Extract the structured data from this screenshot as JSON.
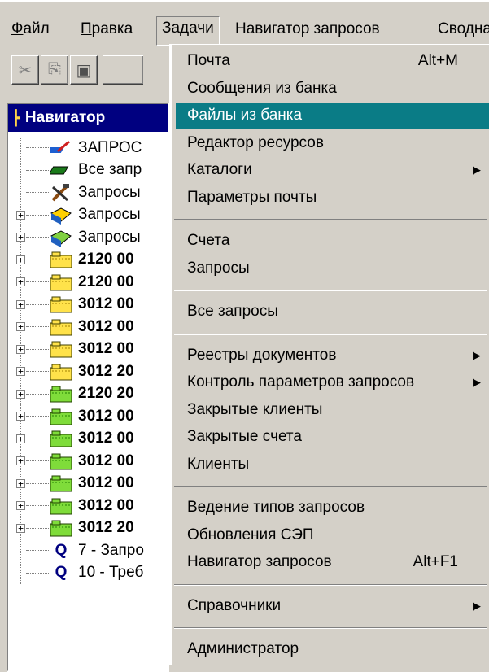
{
  "menubar": {
    "items": [
      {
        "label": "Файл",
        "mnemonic": "Ф",
        "rest": "айл"
      },
      {
        "label": "Правка",
        "mnemonic": "П",
        "rest": "равка"
      },
      {
        "label": "Задачи"
      },
      {
        "label": "Навигатор запросов"
      },
      {
        "label": "Сводна"
      }
    ]
  },
  "toolbar": {
    "buttons": [
      {
        "icon": "scissors-icon",
        "glyph": "✂"
      },
      {
        "icon": "copy-icon",
        "glyph": "⎘"
      },
      {
        "icon": "paste-icon",
        "glyph": "▣"
      }
    ]
  },
  "navigator": {
    "title": "Навигатор",
    "items": [
      {
        "label": "ЗАПРОС",
        "icon": "pencil-book-icon",
        "bold": false,
        "expander": false
      },
      {
        "label": "Все запр",
        "icon": "green-book-icon",
        "bold": false,
        "expander": false
      },
      {
        "label": "Запросы",
        "icon": "tools-icon",
        "bold": false,
        "expander": false
      },
      {
        "label": "Запросы",
        "icon": "yellow-blue-folder-icon",
        "bold": false,
        "expander": true
      },
      {
        "label": "Запросы",
        "icon": "green-blue-folder-icon",
        "bold": false,
        "expander": true
      },
      {
        "label": "2120 00",
        "icon": "yellow-folder-icon",
        "bold": true,
        "expander": true
      },
      {
        "label": "2120 00",
        "icon": "yellow-folder-icon",
        "bold": true,
        "expander": true
      },
      {
        "label": "3012 00",
        "icon": "yellow-folder-icon",
        "bold": true,
        "expander": true
      },
      {
        "label": "3012 00",
        "icon": "yellow-folder-icon",
        "bold": true,
        "expander": true
      },
      {
        "label": "3012 00",
        "icon": "yellow-folder-icon",
        "bold": true,
        "expander": true
      },
      {
        "label": "3012 20",
        "icon": "yellow-folder-icon",
        "bold": true,
        "expander": true
      },
      {
        "label": "2120 20",
        "icon": "green-folder-icon",
        "bold": true,
        "expander": true
      },
      {
        "label": "3012 00",
        "icon": "green-folder-icon",
        "bold": true,
        "expander": true
      },
      {
        "label": "3012 00",
        "icon": "green-folder-icon",
        "bold": true,
        "expander": true
      },
      {
        "label": "3012 00",
        "icon": "green-folder-icon",
        "bold": true,
        "expander": true
      },
      {
        "label": "3012 00",
        "icon": "green-folder-icon",
        "bold": true,
        "expander": true
      },
      {
        "label": "3012 00",
        "icon": "green-folder-icon",
        "bold": true,
        "expander": true
      },
      {
        "label": "3012 20",
        "icon": "green-folder-icon",
        "bold": true,
        "expander": true
      },
      {
        "label": "7 - Запро",
        "icon": "q-icon",
        "bold": false,
        "expander": false
      },
      {
        "label": "10 - Треб",
        "icon": "q-icon",
        "bold": false,
        "expander": false
      }
    ]
  },
  "dropdown": {
    "items": [
      {
        "label": "Почта",
        "shortcut": "Alt+M"
      },
      {
        "label": "Сообщения из банка"
      },
      {
        "label": "Файлы из банка",
        "highlighted": true
      },
      {
        "label": "Редактор ресурсов"
      },
      {
        "label": "Каталоги",
        "submenu": true
      },
      {
        "label": "Параметры почты"
      },
      {
        "separator": true
      },
      {
        "label": "Счета"
      },
      {
        "label": "Запросы"
      },
      {
        "separator": true
      },
      {
        "label": "Все запросы"
      },
      {
        "separator": true
      },
      {
        "label": "Реестры документов",
        "submenu": true
      },
      {
        "label": "Контроль параметров запросов",
        "submenu": true
      },
      {
        "label": "Закрытые клиенты"
      },
      {
        "label": "Закрытые счета"
      },
      {
        "label": "Клиенты"
      },
      {
        "separator": true
      },
      {
        "label": "Ведение типов запросов"
      },
      {
        "label": "Обновления СЭП"
      },
      {
        "label": "Навигатор запросов",
        "shortcut": "Alt+F1"
      },
      {
        "separator": true
      },
      {
        "label": "Справочники",
        "submenu": true
      },
      {
        "separator": true
      },
      {
        "label": "Администратор"
      }
    ]
  },
  "colors": {
    "face": "#d4d0c8",
    "highlight": "#0a7c86",
    "titlebar": "#000080"
  }
}
